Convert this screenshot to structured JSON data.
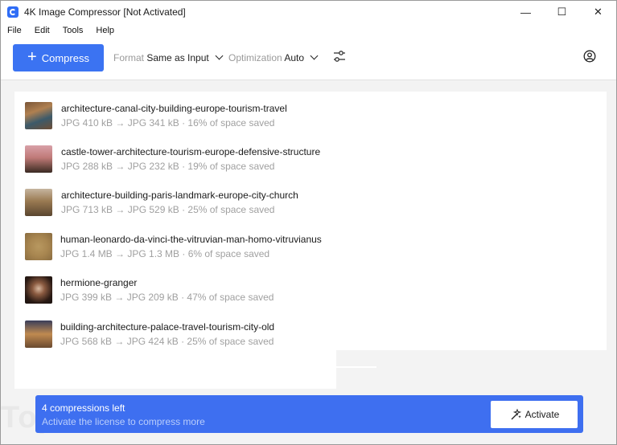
{
  "window": {
    "title": "4K Image Compressor [Not Activated]",
    "controls": {
      "minimize": "—",
      "maximize": "☐",
      "close": "✕"
    }
  },
  "menu": [
    "File",
    "Edit",
    "Tools",
    "Help"
  ],
  "toolbar": {
    "compress_label": "Compress",
    "format_label": "Format",
    "format_value": "Same as Input",
    "optimization_label": "Optimization",
    "optimization_value": "Auto",
    "settings_icon": "sliders-icon",
    "account_icon": "account-icon"
  },
  "files": [
    {
      "name": "architecture-canal-city-building-europe-tourism-travel",
      "meta": "JPG 410 kB → JPG 341 kB · 16% of space saved"
    },
    {
      "name": "castle-tower-architecture-tourism-europe-defensive-structure",
      "meta": "JPG 288 kB → JPG 232 kB · 19% of space saved"
    },
    {
      "name": "architecture-building-paris-landmark-europe-city-church",
      "meta": "JPG 713 kB → JPG 529 kB · 25% of space saved"
    },
    {
      "name": "human-leonardo-da-vinci-the-vitruvian-man-homo-vitruvianus",
      "meta": "JPG 1.4 MB → JPG 1.3 MB · 6% of space saved"
    },
    {
      "name": "hermione-granger",
      "meta": "JPG 399 kB → JPG 209 kB · 47% of space saved"
    },
    {
      "name": "building-architecture-palace-travel-tourism-city-old",
      "meta": "JPG 568 kB → JPG 424 kB · 25% of space saved"
    }
  ],
  "banner": {
    "title": "4 compressions left",
    "subtitle": "Activate the license to compress more",
    "activate_label": "Activate"
  },
  "watermark": "TopWinSoft.de",
  "colors": {
    "accent": "#3b73f2",
    "banner": "#3e6ff0"
  }
}
